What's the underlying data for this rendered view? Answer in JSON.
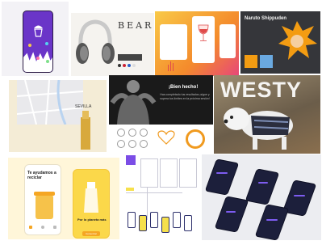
{
  "gallery": {
    "tiles": [
      {
        "id": "cupcake-app"
      },
      {
        "id": "bears-headphones",
        "brand": "BEARS"
      },
      {
        "id": "wine-app"
      },
      {
        "id": "anime-app",
        "title": "Naruto Shippuden"
      },
      {
        "id": "sevilla-map",
        "label": "SEVILLA"
      },
      {
        "id": "fitness-app",
        "headline": "¡Bien hecho!",
        "body": "Has completado tus resultados ¡sigue y supera tus límites en la próxima sesión!"
      },
      {
        "id": "westy-dog",
        "word": "WESTY"
      },
      {
        "id": "recycle-app",
        "headline": "Te ayudamos a reciclar",
        "subheadline": "Por lo planeta más",
        "button": "Comenzar"
      },
      {
        "id": "wireframes"
      },
      {
        "id": "dark-dashboard-app"
      }
    ]
  },
  "colors": {
    "purple": "#6a35c8",
    "wine_orange": "#f7b62a",
    "naruto_orange": "#f39c12",
    "recycle_yellow": "#f5a623",
    "dark_navy": "#1c1f3b",
    "violet_accent": "#7d5cf0"
  }
}
